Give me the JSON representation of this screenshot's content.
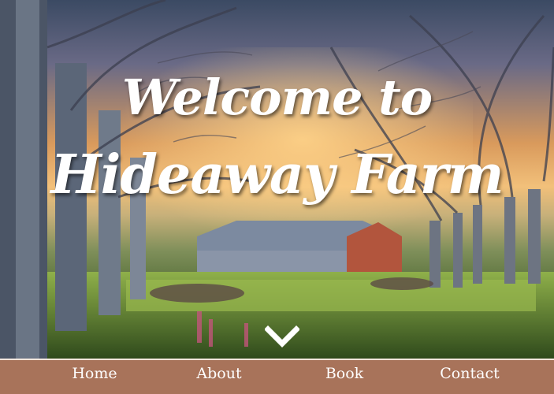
{
  "hero": {
    "headline_line1": "Welcome to",
    "headline_line2": "Hideaway Farm",
    "scroll_icon": "chevron-down-icon"
  },
  "nav": {
    "items": [
      {
        "label": "Home"
      },
      {
        "label": "About"
      },
      {
        "label": "Book"
      },
      {
        "label": "Contact"
      }
    ]
  },
  "colors": {
    "nav_background": "#a8735a",
    "nav_text": "#ffffff",
    "divider": "#f3e6dc",
    "headline": "#ffffff"
  }
}
